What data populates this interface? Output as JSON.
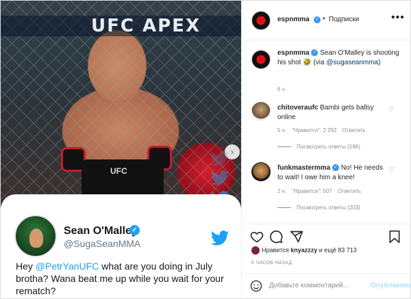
{
  "media": {
    "banner_text": "UFC APEX",
    "shorts_logo": "UFC",
    "card": {
      "name": "Sean O'Malley",
      "handle": "@SugaSeanMMA",
      "tweet_pre": "Hey ",
      "tweet_mention": "@PetrYanUFC",
      "tweet_post": " what are you doing in July brotha? Wana beat me up while you wait for your rematch?"
    }
  },
  "header": {
    "username": "espnmma",
    "dot": "•",
    "follow_label": "Подписки",
    "more_icon": "more-horizontal-icon"
  },
  "caption": {
    "username": "espnmma",
    "text": "Sean O'Malley is shooting his shot 🤣 (via ",
    "mention": "@sugaseanmma",
    "text_end": ")",
    "time": "6 ч."
  },
  "comments": [
    {
      "username": "chitoveraufc",
      "text": "Bambi gets ballsy online",
      "time": "5 ч.",
      "likes": "\"Нравится\": 2 292",
      "reply": "Ответить",
      "replies": "Посмотреть ответы (186)"
    },
    {
      "username": "funkmastermma",
      "text": "No! He needs to wait! I owe him a knee!",
      "time": "2 ч.",
      "likes": "\"Нравится\": 507",
      "reply": "Ответить",
      "replies": "Посмотреть ответы (203)"
    }
  ],
  "likes_line": {
    "prefix": "Нравится",
    "user": "knyazzzy",
    "suffix": "и ещё 83 713"
  },
  "time_ago": "6 ЧАСОВ НАЗАД",
  "add_comment": {
    "placeholder": "Добавьте комментарий...",
    "publish": "Опубликовать"
  },
  "colors": {
    "mention": "#1da1f2",
    "verified": "#3897f0",
    "publish_disabled": "#b2dffc"
  }
}
